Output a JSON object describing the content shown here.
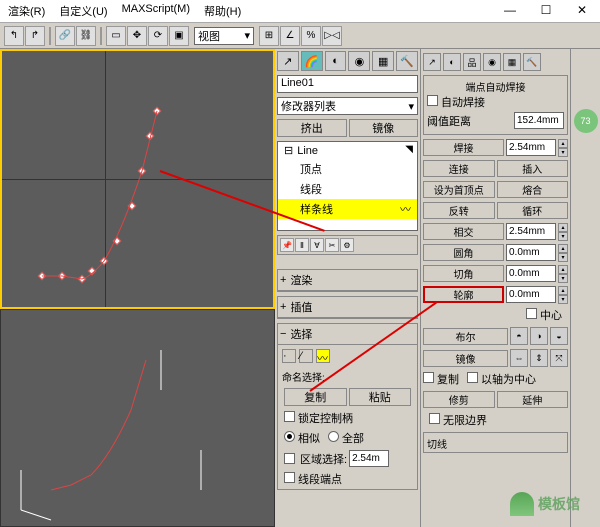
{
  "menu": {
    "render": "渲染(R)",
    "custom": "自定义(U)",
    "maxscript": "MAXScript(M)",
    "help": "帮助(H)"
  },
  "toolbar": {
    "viewport_label": "视图"
  },
  "center": {
    "object_name": "Line01",
    "modifier_list": "修改器列表",
    "extrude": "挤出",
    "mirror": "镜像",
    "tree": {
      "root": "Line",
      "vertex": "顶点",
      "segment": "线段",
      "spline": "样条线"
    },
    "rollout_render": "渲染",
    "rollout_interp": "插值",
    "rollout_select": "选择",
    "name_select": "命名选择:",
    "copy": "复制",
    "paste": "粘贴",
    "lock_handles": "锁定控制柄",
    "similar": "相似",
    "all": "全部",
    "area_select": "区域选择:",
    "area_value": "2.54m",
    "seg_end": "线段端点"
  },
  "right": {
    "auto_weld_group": "端点自动焊接",
    "auto_weld": "自动焊接",
    "threshold": "阈值距离",
    "threshold_val": "152.4mm",
    "weld": "焊接",
    "weld_val": "2.54mm",
    "connect": "连接",
    "insert": "插入",
    "first_vertex": "设为首顶点",
    "fuse": "熔合",
    "reverse": "反转",
    "cycle": "循环",
    "cross": "相交",
    "cross_val": "2.54mm",
    "fillet": "圆角",
    "fillet_val": "0.0mm",
    "chamfer": "切角",
    "chamfer_val": "0.0mm",
    "outline": "轮廓",
    "outline_val": "0.0mm",
    "center": "中心",
    "boolean": "布尔",
    "mirror_btn": "镜像",
    "copy": "复制",
    "axis_center": "以轴为中心",
    "trim": "修剪",
    "extend": "延伸",
    "infinite": "无限边界",
    "tangent": "切线"
  },
  "far_right": {
    "badge": "73"
  },
  "watermark": {
    "text": "模板馆"
  }
}
